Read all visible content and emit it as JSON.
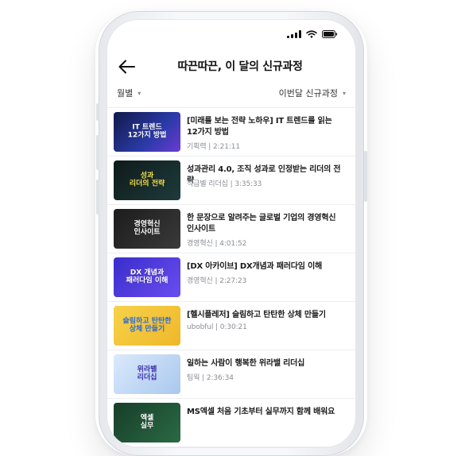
{
  "header": {
    "title": "따끈따끈, 이 달의 신규과정"
  },
  "filters": {
    "left": "월별",
    "right": "이번달 신규과정"
  },
  "colors": {
    "accent": "#111111",
    "meta": "#8a8d93"
  },
  "icons": {
    "back": "arrow-left-icon",
    "signal": "signal-icon",
    "wifi": "wifi-icon",
    "battery": "battery-icon"
  },
  "items": [
    {
      "title": "[미래를 보는 전략 노하우] IT 트렌드를 읽는 12가지 방법",
      "category": "기획력",
      "duration": "2:21:11",
      "thumb_text": "IT 트렌드\n12가지 방법",
      "thumb_bg": "#1a1f5c"
    },
    {
      "title": "성과관리 4.0, 조직 성과로 인정받는 리더의 전략",
      "category": "직급별 리더십",
      "duration": "3:35:33",
      "thumb_text": "성과\n리더의 전략",
      "thumb_bg": "#1e2a2a"
    },
    {
      "title": "한 문장으로 알려주는 글로벌 기업의 경영혁신 인사이트",
      "category": "경영혁신",
      "duration": "4:01:52",
      "thumb_text": "경영혁신\n인사이트",
      "thumb_bg": "#2b2b2b"
    },
    {
      "title": "[DX 아카이브] DX개념과 패러다임 이해",
      "category": "경영혁신",
      "duration": "2:27:23",
      "thumb_text": "DX 개념과\n패러다임 이해",
      "thumb_bg": "#4b3fd8"
    },
    {
      "title": "[헬시플레저] 슬림하고 탄탄한 상체 만들기",
      "category": "ubobful",
      "duration": "0:30:21",
      "thumb_text": "슬림하고 탄탄한\n상체 만들기",
      "thumb_bg": "#f2c43a"
    },
    {
      "title": "일하는 사람이 행복한 위라밸 리더십",
      "category": "팀웍",
      "duration": "2:36:34",
      "thumb_text": "위라밸\n리더십",
      "thumb_bg": "#b9d3f0"
    },
    {
      "title": "MS엑셀 처음 기초부터 실무까지 함께 배워요",
      "category": "",
      "duration": "",
      "thumb_text": "엑셀\n실무",
      "thumb_bg": "#1f4d33"
    }
  ]
}
